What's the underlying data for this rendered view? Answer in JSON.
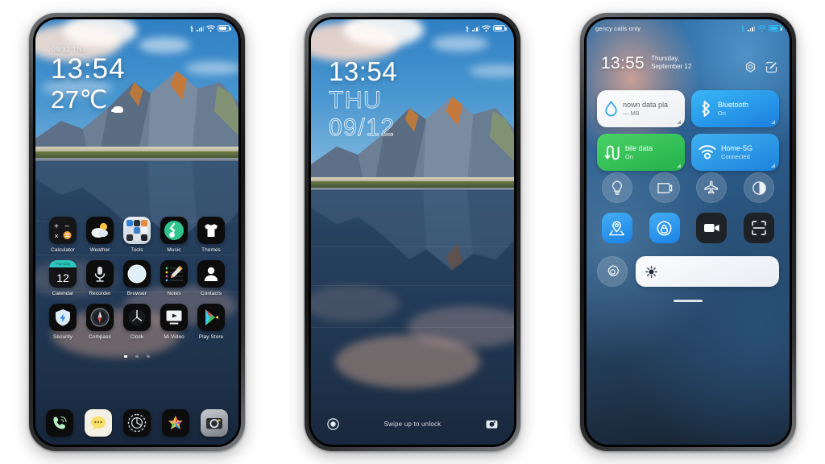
{
  "phone1": {
    "name": "home-screen",
    "statusbar": {
      "left_text": "",
      "icons": [
        "bluetooth-icon",
        "signal-icon",
        "wifi-icon",
        "battery-icon"
      ]
    },
    "widget": {
      "date": "09/12  Thu",
      "time": "13:54",
      "temperature": "27℃",
      "weather_icon": "cloud-icon"
    },
    "rows": [
      [
        {
          "label": "Calculator",
          "icon": "calculator-icon"
        },
        {
          "label": "Weather",
          "icon": "weather-icon"
        },
        {
          "label": "Tools",
          "icon": "folder-icon"
        },
        {
          "label": "Music",
          "icon": "music-note-icon"
        },
        {
          "label": "Themes",
          "icon": "tshirt-icon"
        }
      ],
      [
        {
          "label": "Calendar",
          "icon": "calendar-icon",
          "day_name": "Thursday",
          "day_number": "12"
        },
        {
          "label": "Recorder",
          "icon": "microphone-icon"
        },
        {
          "label": "Browser",
          "icon": "globe-icon"
        },
        {
          "label": "Notes",
          "icon": "notepad-pencil-icon"
        },
        {
          "label": "Contacts",
          "icon": "person-icon"
        }
      ],
      [
        {
          "label": "Security",
          "icon": "shield-icon"
        },
        {
          "label": "Compass",
          "icon": "compass-icon"
        },
        {
          "label": "Clock",
          "icon": "clock-icon"
        },
        {
          "label": "Mi Video",
          "icon": "play-screen-icon"
        },
        {
          "label": "Play Store",
          "icon": "play-store-icon"
        }
      ]
    ],
    "page_dots": {
      "count": 3,
      "active": 1
    },
    "dock": [
      {
        "label": "Phone",
        "icon": "phone-handset-icon"
      },
      {
        "label": "Messages",
        "icon": "chat-bubble-icon"
      },
      {
        "label": "Settings",
        "icon": "gear-icon"
      },
      {
        "label": "Gallery",
        "icon": "flower-photos-icon"
      },
      {
        "label": "Camera",
        "icon": "camera-icon"
      }
    ]
  },
  "phone2": {
    "name": "lock-screen",
    "statusbar": {
      "icons": [
        "bluetooth-icon",
        "signal-icon",
        "wifi-icon",
        "battery-icon"
      ]
    },
    "clock": {
      "time": "13:54",
      "day_of_week": "THU",
      "date": "09/12"
    },
    "footer": {
      "left_icon": "record-circle-icon",
      "hint": "Swipe up to unlock",
      "right_icon": "camera-icon"
    }
  },
  "phone3": {
    "name": "control-center",
    "statusbar": {
      "carrier": "gency calls only",
      "icons": [
        "bluetooth-icon",
        "signal-icon",
        "wifi-icon",
        "battery-icon"
      ]
    },
    "header": {
      "time": "13:55",
      "date": "Thursday, September 12",
      "settings_icon": "settings-circle-icon",
      "edit_icon": "edit-icon"
    },
    "tiles": [
      {
        "title": "nown data pla",
        "subtitle": "— MB",
        "icon": "data-drop-icon",
        "style": "white"
      },
      {
        "title": "Bluetooth",
        "subtitle": "On",
        "icon": "bluetooth-icon",
        "style": "bluetooth"
      },
      {
        "title": "bile data",
        "subtitle": "On",
        "icon": "mobile-data-icon",
        "style": "mobile-data"
      },
      {
        "title": "Home-5G",
        "subtitle": "Connected",
        "icon": "wifi-icon",
        "style": "wifi"
      }
    ],
    "round_toggles": [
      {
        "name": "flashlight-icon",
        "on": false
      },
      {
        "name": "cast-screen-icon",
        "on": false
      },
      {
        "name": "airplane-mode-icon",
        "on": false
      },
      {
        "name": "dark-mode-icon",
        "on": false
      }
    ],
    "square_toggles": [
      {
        "name": "location-icon",
        "on": true
      },
      {
        "name": "lock-security-icon",
        "on": true
      },
      {
        "name": "screen-recorder-icon",
        "on": false
      },
      {
        "name": "scanner-icon",
        "on": false
      }
    ],
    "brightness": {
      "icon": "sun-icon",
      "value": 100,
      "settings_icon": "gear-icon"
    },
    "drag_handle": "panel-drag-handle"
  },
  "colors": {
    "accent_blue": "#1b82e6",
    "accent_green": "#23b14a",
    "page_bg": "#ffffff"
  }
}
